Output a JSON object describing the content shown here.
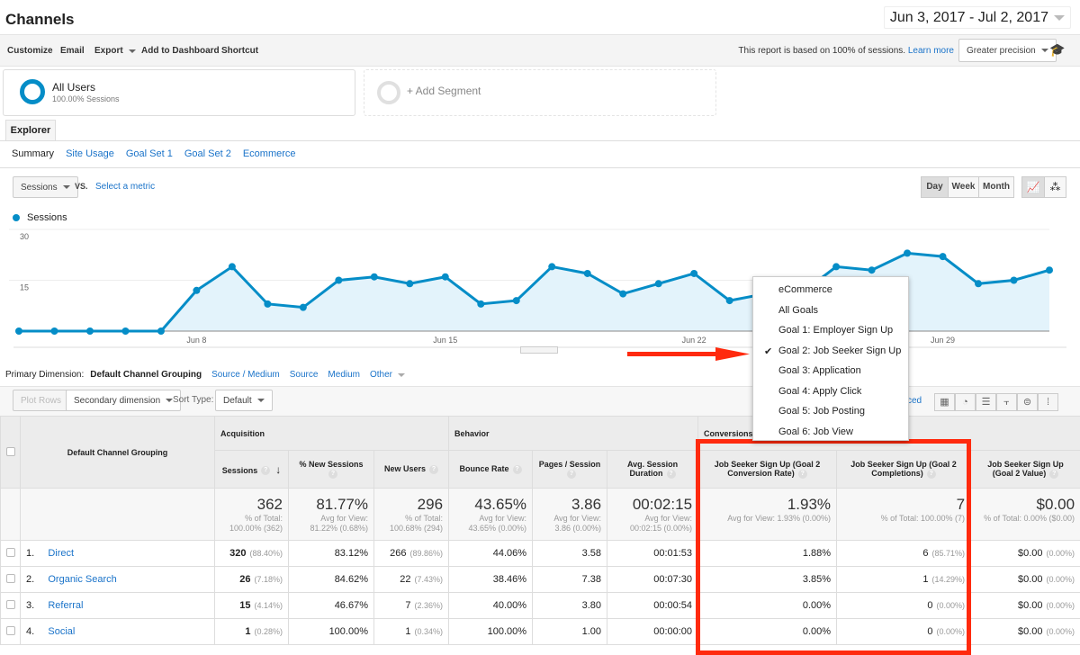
{
  "header": {
    "title": "Channels",
    "date_range": "Jun 3, 2017 - Jul 2, 2017"
  },
  "toolbar": {
    "customize": "Customize",
    "email": "Email",
    "export": "Export",
    "add_to_dashboard": "Add to Dashboard",
    "shortcut": "Shortcut",
    "sampling_text": "This report is based on 100% of sessions.",
    "learn_more": "Learn more",
    "precision": "Greater precision"
  },
  "segments": {
    "all_users": "All Users",
    "all_users_sub": "100.00% Sessions",
    "add_segment": "+ Add Segment"
  },
  "explorer": {
    "tab": "Explorer",
    "subtabs": [
      "Summary",
      "Site Usage",
      "Goal Set 1",
      "Goal Set 2",
      "Ecommerce"
    ]
  },
  "chart_controls": {
    "metric": "Sessions",
    "vs": "VS.",
    "select_metric": "Select a metric",
    "day": "Day",
    "week": "Week",
    "month": "Month"
  },
  "chart_data": {
    "type": "area",
    "series": [
      {
        "name": "Sessions",
        "values": [
          0,
          0,
          0,
          0,
          0,
          12,
          19,
          8,
          7,
          15,
          16,
          14,
          16,
          8,
          9,
          19,
          17,
          11,
          14,
          17,
          9,
          11,
          11,
          19,
          18,
          23,
          22,
          14,
          15,
          18
        ]
      }
    ],
    "x": [
      "Jun 3",
      "Jun 4",
      "Jun 5",
      "Jun 6",
      "Jun 7",
      "Jun 8",
      "Jun 9",
      "Jun 10",
      "Jun 11",
      "Jun 12",
      "Jun 13",
      "Jun 14",
      "Jun 15",
      "Jun 16",
      "Jun 17",
      "Jun 18",
      "Jun 19",
      "Jun 20",
      "Jun 21",
      "Jun 22",
      "Jun 23",
      "Jun 24",
      "Jun 25",
      "Jun 26",
      "Jun 27",
      "Jun 28",
      "Jun 29",
      "Jun 30",
      "Jul 1",
      "Jul 2"
    ],
    "x_tick_labels": [
      "Jun 8",
      "Jun 15",
      "Jun 22",
      "Jun 29"
    ],
    "y_tick_labels": [
      "30",
      "15"
    ],
    "ylim": [
      0,
      30
    ],
    "color": "#058dc7",
    "grid": true,
    "legend": "top-left"
  },
  "dimension": {
    "label": "Primary Dimension:",
    "active": "Default Channel Grouping",
    "options": [
      "Source / Medium",
      "Source",
      "Medium",
      "Other"
    ]
  },
  "table_controls": {
    "plot_rows": "Plot Rows",
    "secondary": "Secondary dimension",
    "sort_label": "Sort Type:",
    "sort_value": "Default",
    "advanced": "ced"
  },
  "goal_menu": {
    "items": [
      "eCommerce",
      "All Goals",
      "Goal 1: Employer Sign Up",
      "Goal 2: Job Seeker Sign Up",
      "Goal 3: Application",
      "Goal 4: Apply Click",
      "Goal 5: Job Posting",
      "Goal 6: Job View"
    ],
    "selected": "Goal 2: Job Seeker Sign Up"
  },
  "table": {
    "groups": [
      "Acquisition",
      "Behavior",
      "Conversions"
    ],
    "dim_header": "Default Channel Grouping",
    "columns": [
      "Sessions",
      "% New Sessions",
      "New Users",
      "Bounce Rate",
      "Pages / Session",
      "Avg. Session Duration",
      "Job Seeker Sign Up (Goal 2 Conversion Rate)",
      "Job Seeker Sign Up (Goal 2 Completions)",
      "Job Seeker Sign Up (Goal 2 Value)"
    ],
    "totals": [
      [
        "362",
        "% of Total:",
        "100.00% (362)"
      ],
      [
        "81.77%",
        "Avg for View:",
        "81.22% (0.68%)"
      ],
      [
        "296",
        "% of Total:",
        "100.68% (294)"
      ],
      [
        "43.65%",
        "Avg for View:",
        "43.65% (0.00%)"
      ],
      [
        "3.86",
        "Avg for View:",
        "3.86 (0.00%)"
      ],
      [
        "00:02:15",
        "Avg for View:",
        "00:02:15 (0.00%)"
      ],
      [
        "1.93%",
        "Avg for View: 1.93% (0.00%)",
        ""
      ],
      [
        "7",
        "% of Total: 100.00% (7)",
        ""
      ],
      [
        "$0.00",
        "% of Total: 0.00% ($0.00)",
        ""
      ]
    ],
    "rows": [
      {
        "n": "1.",
        "name": "Direct",
        "sessions": "320",
        "sessions_pct": "(88.40%)",
        "new_sessions": "83.12%",
        "new_users": "266",
        "new_users_pct": "(89.86%)",
        "bounce": "44.06%",
        "pages": "3.58",
        "duration": "00:01:53",
        "conv": "1.88%",
        "comp": "6",
        "comp_pct": "(85.71%)",
        "value": "$0.00",
        "value_pct": "(0.00%)"
      },
      {
        "n": "2.",
        "name": "Organic Search",
        "sessions": "26",
        "sessions_pct": "(7.18%)",
        "new_sessions": "84.62%",
        "new_users": "22",
        "new_users_pct": "(7.43%)",
        "bounce": "38.46%",
        "pages": "7.38",
        "duration": "00:07:30",
        "conv": "3.85%",
        "comp": "1",
        "comp_pct": "(14.29%)",
        "value": "$0.00",
        "value_pct": "(0.00%)"
      },
      {
        "n": "3.",
        "name": "Referral",
        "sessions": "15",
        "sessions_pct": "(4.14%)",
        "new_sessions": "46.67%",
        "new_users": "7",
        "new_users_pct": "(2.36%)",
        "bounce": "40.00%",
        "pages": "3.80",
        "duration": "00:00:54",
        "conv": "0.00%",
        "comp": "0",
        "comp_pct": "(0.00%)",
        "value": "$0.00",
        "value_pct": "(0.00%)"
      },
      {
        "n": "4.",
        "name": "Social",
        "sessions": "1",
        "sessions_pct": "(0.28%)",
        "new_sessions": "100.00%",
        "new_users": "1",
        "new_users_pct": "(0.34%)",
        "bounce": "100.00%",
        "pages": "1.00",
        "duration": "00:00:00",
        "conv": "0.00%",
        "comp": "0",
        "comp_pct": "(0.00%)",
        "value": "$0.00",
        "value_pct": "(0.00%)"
      }
    ]
  },
  "colors": {
    "accent": "#058dc7",
    "link": "#1a73c9",
    "highlight": "#ff2a0e"
  }
}
